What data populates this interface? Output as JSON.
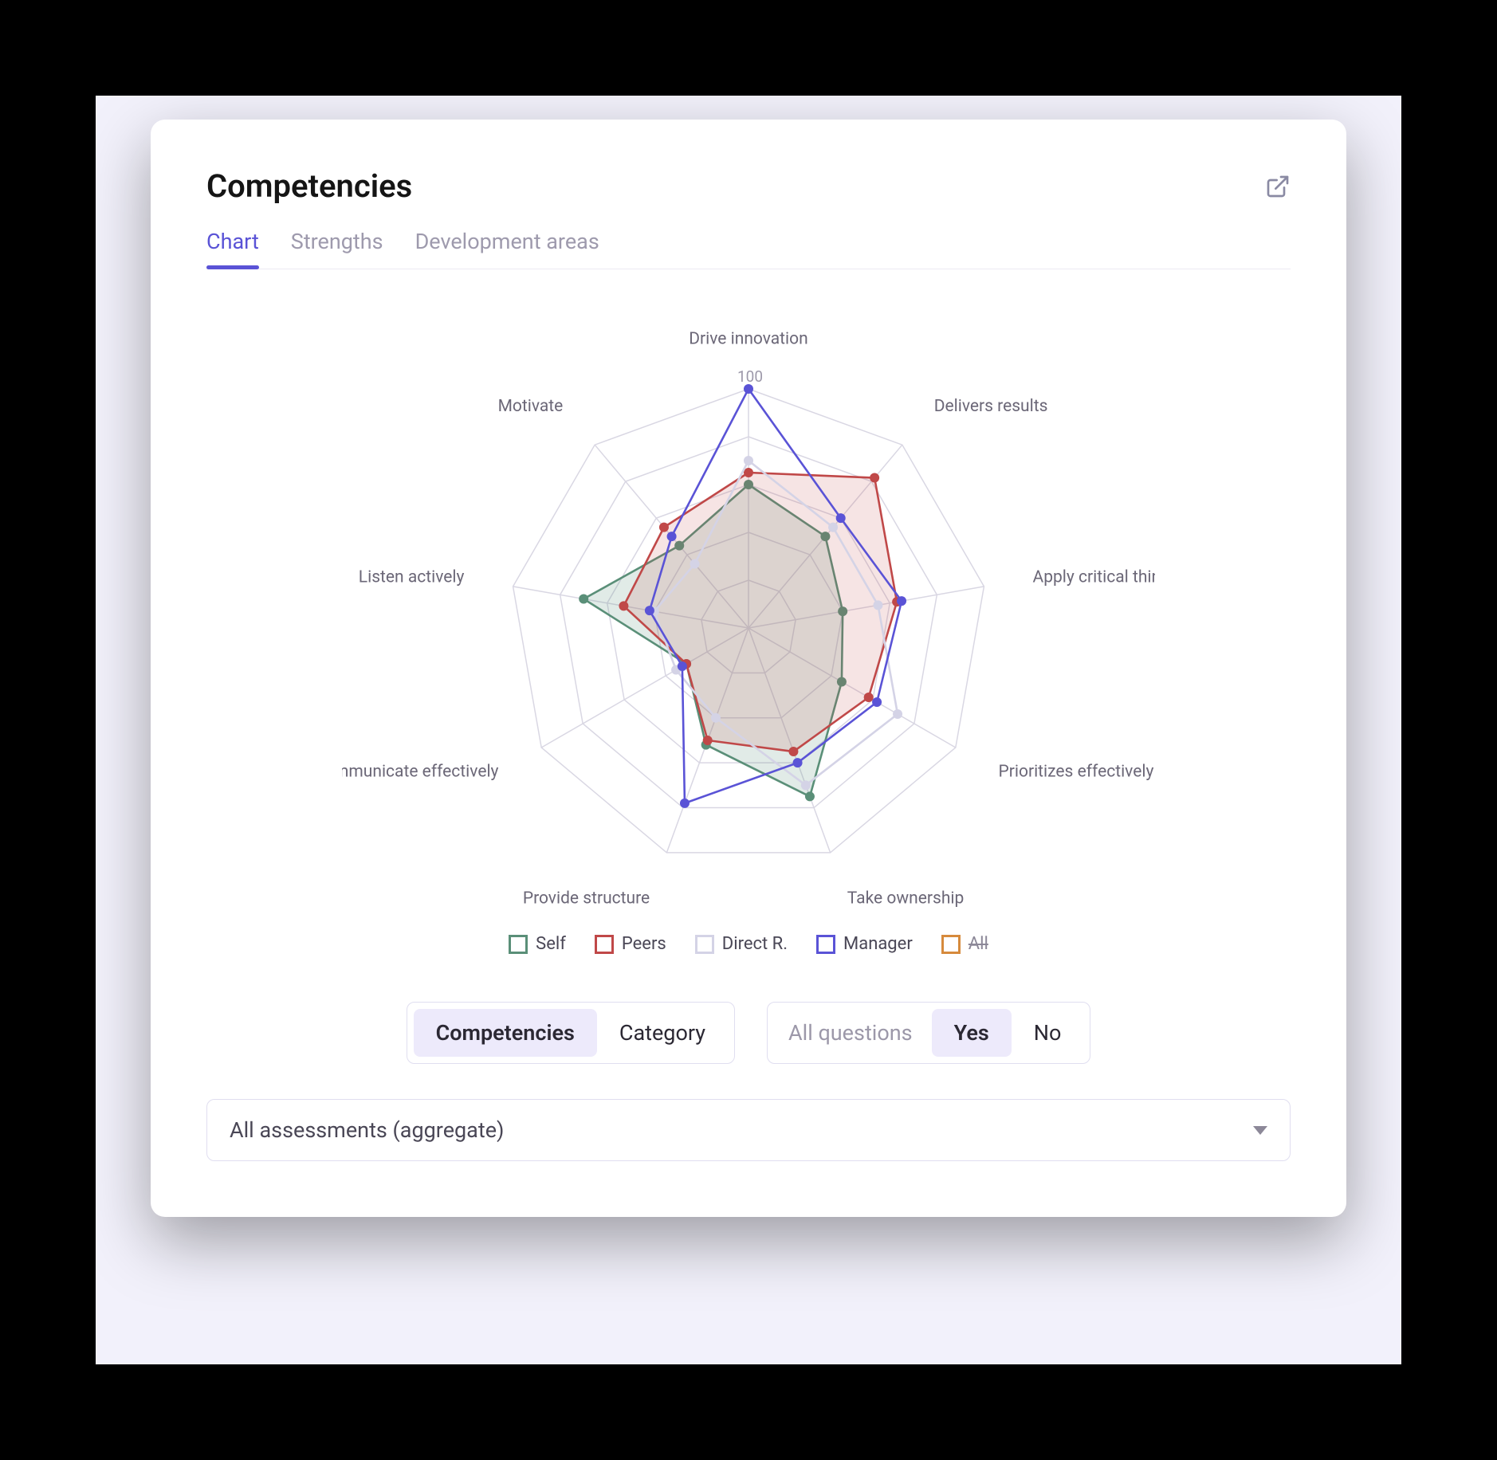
{
  "header": {
    "title": "Competencies"
  },
  "tabs": [
    {
      "label": "Chart",
      "active": true
    },
    {
      "label": "Strengths",
      "active": false
    },
    {
      "label": "Development areas",
      "active": false
    }
  ],
  "chart_data": {
    "type": "radar",
    "max": 100,
    "tick": "100",
    "axes": [
      "Drive innovation",
      "Delivers results",
      "Apply critical thinking",
      "Prioritizes effectively",
      "Take ownership",
      "Provide structure",
      "Communicate effectively",
      "Listen actively",
      "Motivate"
    ],
    "series": [
      {
        "name": "Self",
        "color": "#5a8f78",
        "fill": "rgba(90,143,120,0.18)",
        "enabled": true,
        "values": [
          60,
          50,
          40,
          45,
          75,
          52,
          30,
          70,
          45
        ]
      },
      {
        "name": "Peers",
        "color": "#c04848",
        "fill": "rgba(192,72,72,0.15)",
        "enabled": true,
        "values": [
          65,
          82,
          63,
          58,
          55,
          50,
          30,
          53,
          55
        ]
      },
      {
        "name": "Direct R.",
        "color": "#d4d3e6",
        "fill": "none",
        "enabled": true,
        "values": [
          70,
          55,
          55,
          72,
          70,
          40,
          35,
          40,
          35
        ]
      },
      {
        "name": "Manager",
        "color": "#5a53d6",
        "fill": "none",
        "enabled": true,
        "values": [
          100,
          60,
          65,
          62,
          60,
          78,
          32,
          42,
          50
        ]
      },
      {
        "name": "All",
        "color": "#d68a3c",
        "fill": "none",
        "enabled": false,
        "values": null
      }
    ]
  },
  "legend": [
    {
      "name": "Self",
      "color": "#5a8f78",
      "disabled": false
    },
    {
      "name": "Peers",
      "color": "#c04848",
      "disabled": false
    },
    {
      "name": "Direct R.",
      "color": "#d4d3e6",
      "disabled": false
    },
    {
      "name": "Manager",
      "color": "#5a53d6",
      "disabled": false
    },
    {
      "name": "All",
      "color": "#d68a3c",
      "disabled": true
    }
  ],
  "controls": {
    "view_toggle": {
      "options": [
        "Competencies",
        "Category"
      ],
      "selected": "Competencies"
    },
    "question_toggle": {
      "label": "All questions",
      "options": [
        "Yes",
        "No"
      ],
      "selected": "Yes"
    }
  },
  "dropdown": {
    "selected": "All assessments (aggregate)"
  }
}
